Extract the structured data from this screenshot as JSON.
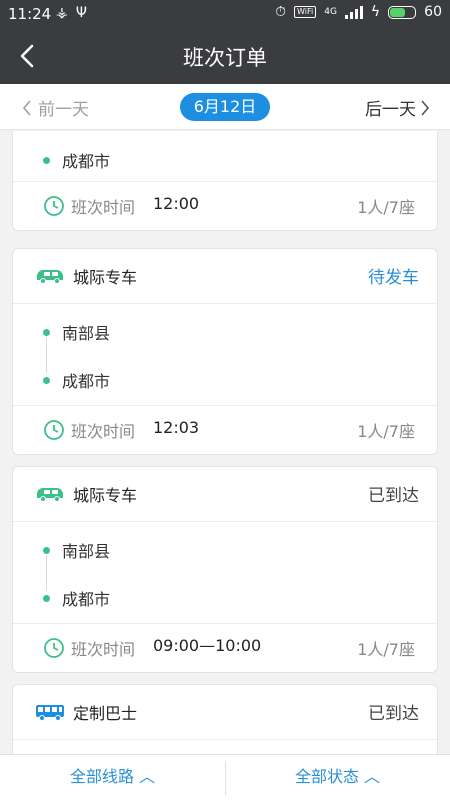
{
  "status_bar": {
    "time": "11:24",
    "wifi_label": "WiFi",
    "network": "4G",
    "battery": "60",
    "left_icons": [
      "share-icon",
      "usb-icon"
    ]
  },
  "header": {
    "title": "班次订单",
    "back_icon": "chevron-left-icon"
  },
  "date_bar": {
    "prev_label": "前一天",
    "current_date": "6月12日",
    "next_label": "后一天",
    "accent_color": "#1e8ee0"
  },
  "orders": [
    {
      "type": "",
      "status": "",
      "stops": [
        "",
        "成都市"
      ],
      "time_label": "班次时间",
      "time": "12:00",
      "seats": "1人/7座"
    },
    {
      "type": "城际专车",
      "vehicle_icon": "van-icon",
      "status": "待发车",
      "stops": [
        "南部县",
        "成都市"
      ],
      "time_label": "班次时间",
      "time": "12:03",
      "seats": "1人/7座"
    },
    {
      "type": "城际专车",
      "vehicle_icon": "van-icon",
      "status": "已到达",
      "stops": [
        "南部县",
        "成都市"
      ],
      "time_label": "班次时间",
      "time": "09:00—10:00",
      "seats": "1人/7座"
    },
    {
      "type": "定制巴士",
      "vehicle_icon": "bus-icon",
      "status": "已到达"
    }
  ],
  "bottom_bar": {
    "routes_label": "全部线路",
    "status_label": "全部状态"
  },
  "colors": {
    "header_bg": "#3a3c40",
    "stop_dot": "#3cc08a",
    "pending_status": "#2b8fd6",
    "link_blue": "#2b8fd6"
  }
}
